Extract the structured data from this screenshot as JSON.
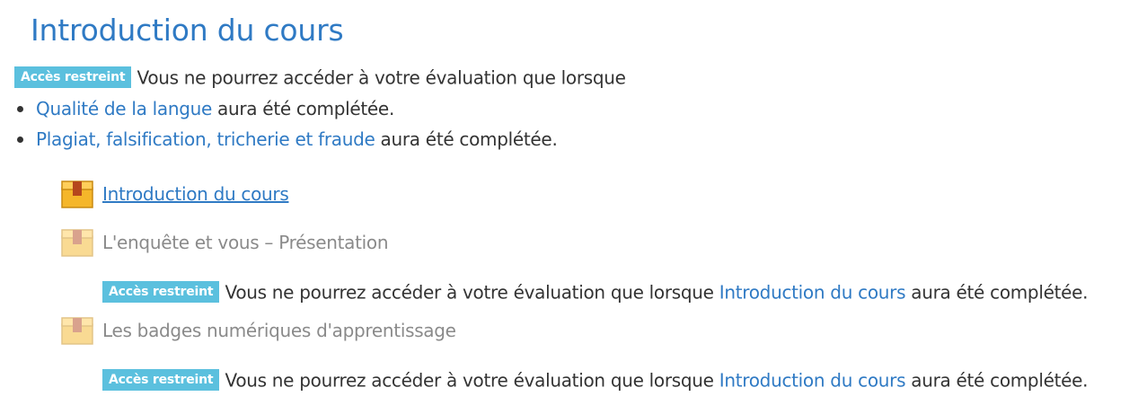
{
  "section": {
    "title": "Introduction du cours",
    "restriction": {
      "badge": "Accès restreint",
      "text": "Vous ne pourrez accéder à votre évaluation que lorsque",
      "conditions": [
        {
          "link": "Qualité de la langue",
          "suffix": " aura été complétée."
        },
        {
          "link": "Plagiat, falsification, tricherie et fraude",
          "suffix": " aura été complétée."
        }
      ]
    }
  },
  "activities": [
    {
      "name": "Introduction du cours",
      "state": "available",
      "icon": "package-icon"
    },
    {
      "name": "L'enquête et vous – Présentation",
      "state": "restricted",
      "icon": "package-icon",
      "restriction": {
        "badge": "Accès restreint",
        "text_before": "Vous ne pourrez accéder à votre évaluation que lorsque ",
        "link": "Introduction du cours",
        "text_after": " aura été complétée."
      }
    },
    {
      "name": "Les badges numériques d'apprentissage",
      "state": "restricted",
      "icon": "package-icon",
      "restriction": {
        "badge": "Accès restreint",
        "text_before": "Vous ne pourrez accéder à votre évaluation que lorsque ",
        "link": "Introduction du cours",
        "text_after": " aura été complétée."
      }
    }
  ],
  "colors": {
    "link": "#2f7ac4",
    "badge": "#5bc0de",
    "text": "#333333",
    "dimmed": "#8a8a8a"
  }
}
